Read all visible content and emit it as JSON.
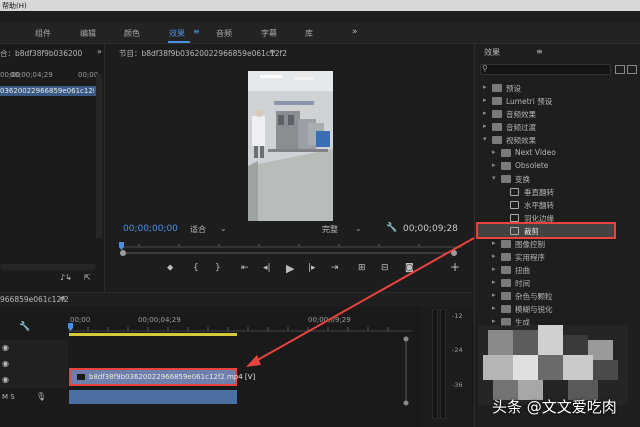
{
  "menubar": {
    "label": "帮助(H)"
  },
  "workspace_tabs": [
    {
      "label": "组件",
      "active": false
    },
    {
      "label": "编辑",
      "active": false
    },
    {
      "label": "颜色",
      "active": false
    },
    {
      "label": "效果",
      "active": true
    },
    {
      "label": "音频",
      "active": false
    },
    {
      "label": "字幕",
      "active": false
    },
    {
      "label": "库",
      "active": false
    }
  ],
  "source_panel": {
    "title": "合：b8df38f9b036200",
    "timecode_start": "00;00",
    "timecode_mid": "00;00;04;29",
    "timecode_end": "00;00",
    "clip": "03620022966859e061c12f2.m"
  },
  "program_monitor": {
    "title": "节目：b8df38f9b03620022966859e061c12f2",
    "timecode_current": "00;00;00;00",
    "fit": "适合",
    "resolution": "完整",
    "timecode_duration": "00;00;09;28"
  },
  "effects_panel": {
    "title": "效果",
    "search_placeholder": "",
    "items": [
      {
        "label": "预设",
        "level": 0,
        "kind": "folder",
        "open": false
      },
      {
        "label": "Lumetri 预设",
        "level": 0,
        "kind": "folder",
        "open": false
      },
      {
        "label": "音频效果",
        "level": 0,
        "kind": "folder",
        "open": false
      },
      {
        "label": "音频过渡",
        "level": 0,
        "kind": "folder",
        "open": false
      },
      {
        "label": "视频效果",
        "level": 0,
        "kind": "folder",
        "open": true
      },
      {
        "label": "Next Video",
        "level": 1,
        "kind": "folder",
        "open": false
      },
      {
        "label": "Obsolete",
        "level": 1,
        "kind": "folder",
        "open": false
      },
      {
        "label": "变换",
        "level": 1,
        "kind": "folder",
        "open": true
      },
      {
        "label": "垂直翻转",
        "level": 2,
        "kind": "effect"
      },
      {
        "label": "水平翻转",
        "level": 2,
        "kind": "effect"
      },
      {
        "label": "羽化边缘",
        "level": 2,
        "kind": "effect"
      },
      {
        "label": "裁剪",
        "level": 2,
        "kind": "effect",
        "selected": true
      },
      {
        "label": "图像控制",
        "level": 1,
        "kind": "folder",
        "open": false
      },
      {
        "label": "实用程序",
        "level": 1,
        "kind": "folder",
        "open": false
      },
      {
        "label": "扭曲",
        "level": 1,
        "kind": "folder",
        "open": false
      },
      {
        "label": "时间",
        "level": 1,
        "kind": "folder",
        "open": false
      },
      {
        "label": "杂色与颗粒",
        "level": 1,
        "kind": "folder",
        "open": false
      },
      {
        "label": "模糊与锐化",
        "level": 1,
        "kind": "folder",
        "open": false
      },
      {
        "label": "生成",
        "level": 1,
        "kind": "folder",
        "open": false
      }
    ]
  },
  "timeline": {
    "sequence_name": "966859e061c12f2",
    "ruler": [
      "00;00",
      "00;00;04;29",
      "00;00;09;29"
    ],
    "clip_label": "b8df38f9b03620022966859e061c12f2.mp4 [V]",
    "audio_labels": "M   S"
  },
  "meters": {
    "db_labels": [
      "-12",
      "-24",
      "-36"
    ]
  },
  "watermark": {
    "text": "头条 @文文爱吃肉"
  },
  "colors": {
    "accent": "#4a90e2",
    "highlight_border": "#e8433f",
    "selection_bg": "#3a5a86"
  }
}
